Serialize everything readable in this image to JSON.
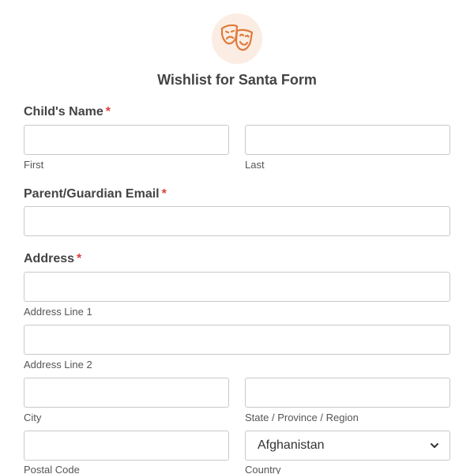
{
  "form": {
    "title": "Wishlist for Santa Form",
    "logo_icon": "theater-masks-icon",
    "accent_color": "#e07b3c",
    "required_color": "#e0403b",
    "required_marker": "*"
  },
  "fields": {
    "child_name": {
      "label": "Child's Name",
      "first_sublabel": "First",
      "last_sublabel": "Last",
      "first_value": "",
      "last_value": ""
    },
    "email": {
      "label": "Parent/Guardian Email",
      "value": ""
    },
    "address": {
      "label": "Address",
      "line1_sublabel": "Address Line 1",
      "line2_sublabel": "Address Line 2",
      "city_sublabel": "City",
      "state_sublabel": "State / Province / Region",
      "postal_sublabel": "Postal Code",
      "country_sublabel": "Country",
      "country_value": "Afghanistan",
      "line1_value": "",
      "line2_value": "",
      "city_value": "",
      "state_value": "",
      "postal_value": ""
    }
  }
}
